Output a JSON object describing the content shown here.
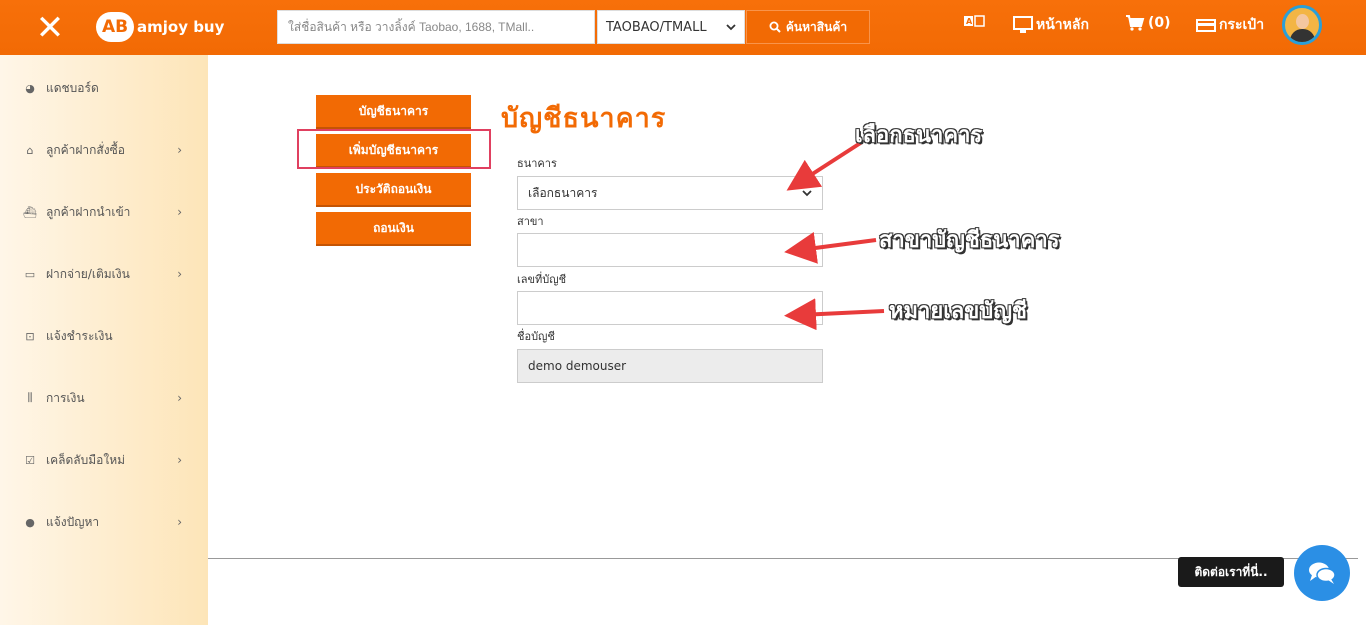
{
  "header": {
    "close_icon": "close-icon",
    "logo_badge": "AB",
    "logo_text": "amjoy buy",
    "search_placeholder": "ใส่ชื่อสินค้า หรือ วางลิ้งค์ Taobao, 1688, TMall..",
    "platform_selected": "TAOBAO/TMALL",
    "search_button": "ค้นหาสินค้า",
    "translate_icon": "translate-icon",
    "home_label": "หน้าหลัก",
    "cart_label": "(0)",
    "wallet_label": "กระเป๋า",
    "accent_color": "#f26a04"
  },
  "sidebar": {
    "items": [
      {
        "label": "แดชบอร์ด",
        "icon": "pie-chart-icon",
        "has_submenu": false
      },
      {
        "label": "ลูกค้าฝากสั่งซื้อ",
        "icon": "basket-icon",
        "has_submenu": true
      },
      {
        "label": "ลูกค้าฝากนำเข้า",
        "icon": "ship-icon",
        "has_submenu": true
      },
      {
        "label": "ฝากจ่าย/เติมเงิน",
        "icon": "credit-card-icon",
        "has_submenu": true
      },
      {
        "label": "แจ้งชำระเงิน",
        "icon": "money-icon",
        "has_submenu": false
      },
      {
        "label": "การเงิน",
        "icon": "bank-icon",
        "has_submenu": true
      },
      {
        "label": "เคล็ดลับมือใหม่",
        "icon": "checkbox-icon",
        "has_submenu": true
      },
      {
        "label": "แจ้งปัญหา",
        "icon": "comments-icon",
        "has_submenu": true
      }
    ]
  },
  "tabs": [
    {
      "label": "บัญชีธนาคาร"
    },
    {
      "label": "เพิ่มบัญชีธนาคาร"
    },
    {
      "label": "ประวัติถอนเงิน"
    },
    {
      "label": "ถอนเงิน"
    }
  ],
  "form": {
    "title": "บัญชีธนาคาร",
    "bank_label": "ธนาคาร",
    "bank_selected": "เลือกธนาคาร",
    "branch_label": "สาขา",
    "branch_value": "",
    "account_no_label": "เลขที่บัญชี",
    "account_no_value": "",
    "account_name_label": "ชื่อบัญชี",
    "account_name_value": "demo demouser"
  },
  "annotations": {
    "select_bank": "เลือกธนาคาร",
    "branch": "สาขาบัญชีธนาคาร",
    "account_no": "หมายเลขบัญชี"
  },
  "contact": {
    "label": "ติดต่อเราที่นี่..",
    "chat_icon": "chat-icon"
  }
}
